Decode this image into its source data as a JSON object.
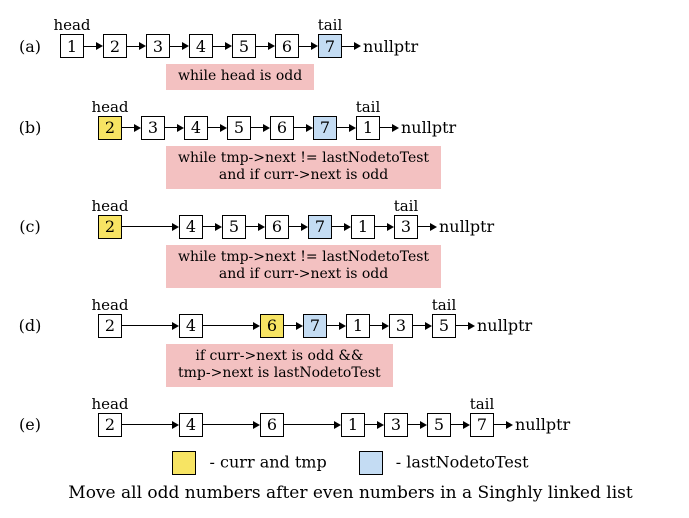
{
  "labels": {
    "head": "head",
    "tail": "tail",
    "nullptr": "nullptr"
  },
  "rows": [
    {
      "id": "a",
      "label": "(a)",
      "indent": 0,
      "arrow": 12,
      "nodes": [
        {
          "v": "1",
          "top": "head"
        },
        {
          "v": "2"
        },
        {
          "v": "3"
        },
        {
          "v": "4"
        },
        {
          "v": "5"
        },
        {
          "v": "6"
        },
        {
          "v": "7",
          "cls": "blue",
          "top": "tail"
        }
      ],
      "cond": "while head is odd"
    },
    {
      "id": "b",
      "label": "(b)",
      "indent": 38,
      "arrow": 12,
      "nodes": [
        {
          "v": "2",
          "cls": "yellow",
          "top": "head"
        },
        {
          "v": "3"
        },
        {
          "v": "4"
        },
        {
          "v": "5"
        },
        {
          "v": "6"
        },
        {
          "v": "7",
          "cls": "blue"
        },
        {
          "v": "1",
          "top": "tail"
        }
      ],
      "cond": "while tmp->next != lastNodetoTest\nand if curr->next is odd"
    },
    {
      "id": "c",
      "label": "(c)",
      "indent": 38,
      "arrow": 12,
      "long_after": 0,
      "nodes": [
        {
          "v": "2",
          "cls": "yellow",
          "top": "head"
        },
        {
          "v": "4"
        },
        {
          "v": "5"
        },
        {
          "v": "6"
        },
        {
          "v": "7",
          "cls": "blue"
        },
        {
          "v": "1"
        },
        {
          "v": "3",
          "top": "tail"
        }
      ],
      "cond": "while tmp->next != lastNodetoTest\nand if curr->next is odd"
    },
    {
      "id": "d",
      "label": "(d)",
      "indent": 38,
      "arrow": 12,
      "long_after": 0,
      "long_after2": 1,
      "nodes": [
        {
          "v": "2",
          "top": "head"
        },
        {
          "v": "4"
        },
        {
          "v": "6",
          "cls": "yellow"
        },
        {
          "v": "7",
          "cls": "blue"
        },
        {
          "v": "1"
        },
        {
          "v": "3"
        },
        {
          "v": "5",
          "top": "tail"
        }
      ],
      "cond": "if curr->next is odd &&\ntmp->next is lastNodetoTest"
    },
    {
      "id": "e",
      "label": "(e)",
      "indent": 38,
      "arrow": 12,
      "long_after": 0,
      "long_after2": 1,
      "long_after3": 2,
      "nodes": [
        {
          "v": "2",
          "top": "head"
        },
        {
          "v": "4"
        },
        {
          "v": "6"
        },
        {
          "v": "1"
        },
        {
          "v": "3"
        },
        {
          "v": "5"
        },
        {
          "v": "7",
          "top": "tail"
        }
      ]
    }
  ],
  "legend": {
    "curr": "- curr and tmp",
    "last": "- lastNodetoTest"
  },
  "caption": "Move all odd numbers after even numbers in a Singhly linked list"
}
